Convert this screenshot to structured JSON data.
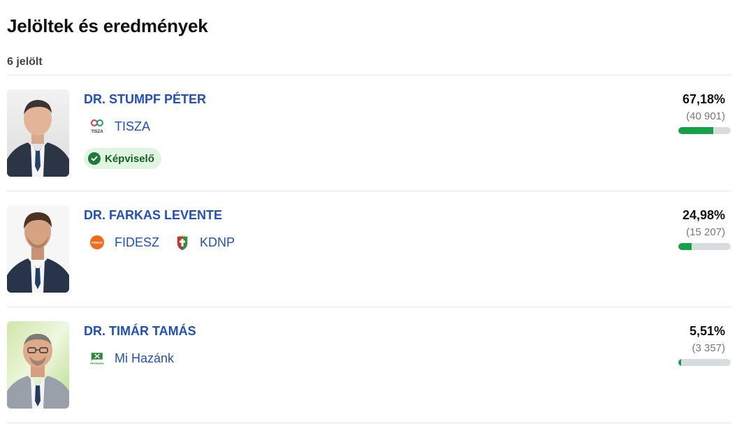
{
  "header": {
    "title": "Jelöltek és eredmények",
    "count": "6 jelölt"
  },
  "candidates": [
    {
      "name": "DR. STUMPF PÉTER",
      "parties": [
        {
          "name": "TISZA",
          "logo_text": "TISZA",
          "logo": "tisza-logo"
        }
      ],
      "badge": "Képviselő",
      "percent": "67,18%",
      "votes": "(40 901)",
      "share": 0.6718
    },
    {
      "name": "DR. FARKAS LEVENTE",
      "parties": [
        {
          "name": "FIDESZ",
          "logo_text": "FIDESZ",
          "logo": "fidesz-logo"
        },
        {
          "name": "KDNP",
          "logo_text": "",
          "logo": "kdnp-logo"
        }
      ],
      "badge": "",
      "percent": "24,98%",
      "votes": "(15 207)",
      "share": 0.2498
    },
    {
      "name": "DR. TIMÁR TAMÁS",
      "parties": [
        {
          "name": "Mi Hazánk",
          "logo_text": "Mi Hazánk",
          "logo": "mihazank-logo"
        }
      ],
      "badge": "",
      "percent": "5,51%",
      "votes": "(3 357)",
      "share": 0.0551
    }
  ],
  "colors": {
    "accent": "#1f4fc2",
    "bar_fill": "#16a04a",
    "bar_track": "#d9dcdf",
    "badge_bg": "#dff5df"
  }
}
